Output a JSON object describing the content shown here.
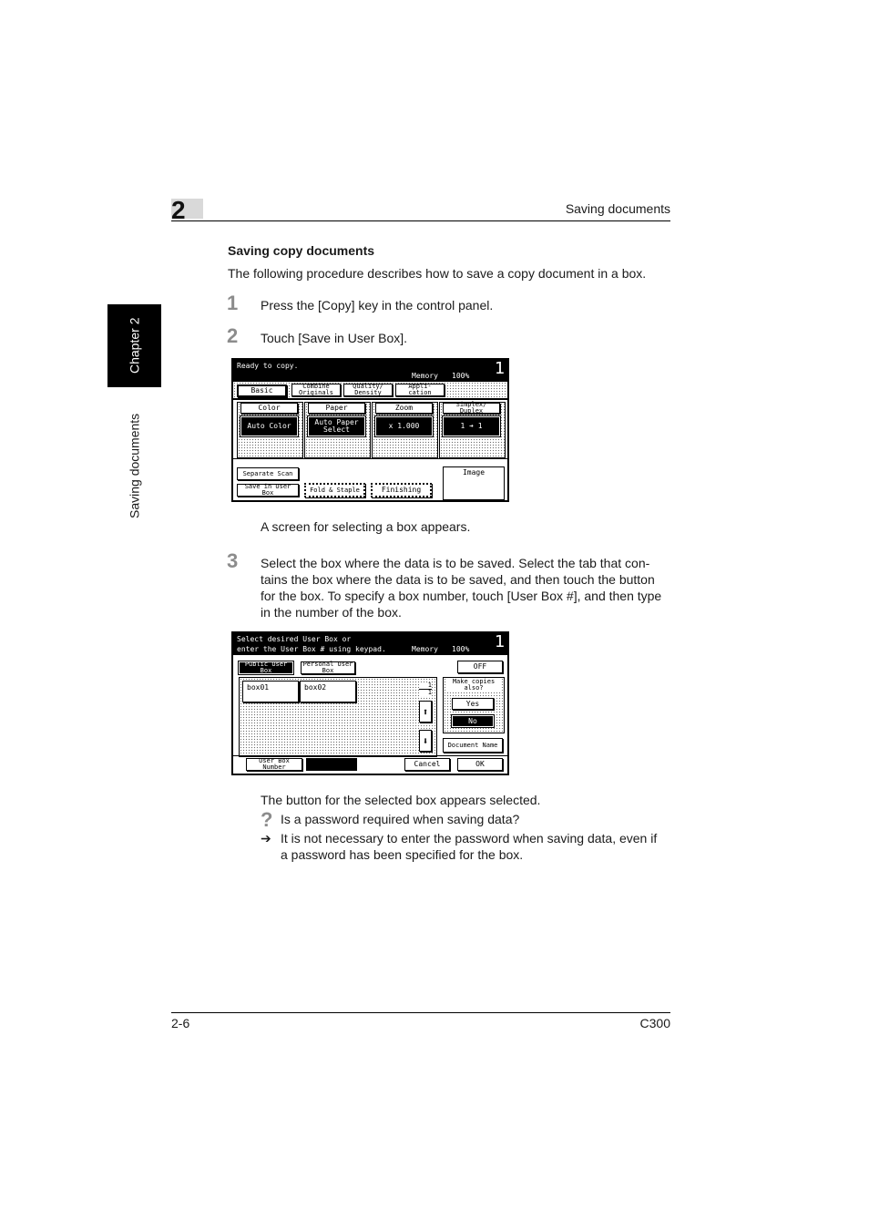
{
  "header": {
    "chapter_number": "2",
    "title": "Saving documents"
  },
  "side_tab": {
    "chapter": "Chapter 2",
    "section": "Saving documents"
  },
  "section": {
    "heading": "Saving copy documents",
    "intro": "The following procedure describes how to save a copy document in a box."
  },
  "steps": [
    {
      "number": "1",
      "text": "Press the [Copy] key in the control panel."
    },
    {
      "number": "2",
      "text": "Touch [Save in User Box]."
    },
    {
      "number": "3",
      "lines": [
        "Select the box where the data is to be saved. Select the tab that con-",
        "tains the box where the data is to be saved, and then touch the button",
        "for the box. To specify a box number, touch [User Box #], and then type",
        "in the number of the box."
      ]
    }
  ],
  "screen1": {
    "status": "Ready to copy.",
    "memory": "Memory",
    "memory_value": "100%",
    "count": "1",
    "tabs": [
      "Basic",
      "Combine Originals",
      "Quality/ Density",
      "Appli- cation"
    ],
    "groups": [
      {
        "label": "Color",
        "value": "Auto Color"
      },
      {
        "label": "Paper",
        "value": "Auto Paper Select"
      },
      {
        "label": "Zoom",
        "value": "x 1.000"
      },
      {
        "label": "Simplex/ Duplex",
        "value": "1 ➔ 1"
      }
    ],
    "separate_scan": "Separate Scan",
    "save_in_user_box": "Save in User Box",
    "fold_staple": "Fold & Staple",
    "finishing": "Finishing",
    "image": "Image"
  },
  "caption1": "A screen for selecting a box appears.",
  "screen2": {
    "status_line1": "Select desired User Box or",
    "status_line2": "enter the User Box # using keypad.",
    "memory": "Memory",
    "memory_value": "100%",
    "count": "1",
    "tab_public": "Public User Box",
    "tab_personal": "Personal User Box",
    "off": "OFF",
    "boxes": [
      "box01",
      "box02"
    ],
    "page_top": "1",
    "page_bottom": "1",
    "make_copies": "Make copies also?",
    "yes": "Yes",
    "no": "No",
    "document_name": "Document Name",
    "user_box_number": "User Box Number",
    "cancel": "Cancel",
    "ok": "OK"
  },
  "caption2": "The button for the selected box appears selected.",
  "qa": {
    "question_icon": "?",
    "question": "Is a password required when saving data?",
    "answer_icon": "➔",
    "answer_lines": [
      "It is not necessary to enter the password when saving data, even if",
      "a password has been specified for the box."
    ]
  },
  "footer": {
    "page": "2-6",
    "model": "C300"
  }
}
